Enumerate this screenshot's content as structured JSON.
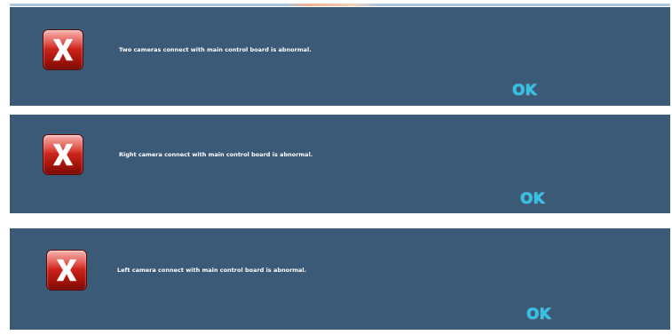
{
  "dialogs": [
    {
      "icon": "error-x-icon",
      "message": "Two cameras connect with main control board is abnormal.",
      "ok_label": "OK"
    },
    {
      "icon": "error-x-icon",
      "message": "Right camera connect with main control board is abnormal.",
      "ok_label": "OK"
    },
    {
      "icon": "error-x-icon",
      "message": "Left camera connect with main control board is abnormal.",
      "ok_label": "OK"
    }
  ],
  "colors": {
    "panel_background": "#3b5a78",
    "ok_text": "#2ec4e8",
    "icon_red": "#c8241b",
    "message_text": "#ffffff"
  }
}
